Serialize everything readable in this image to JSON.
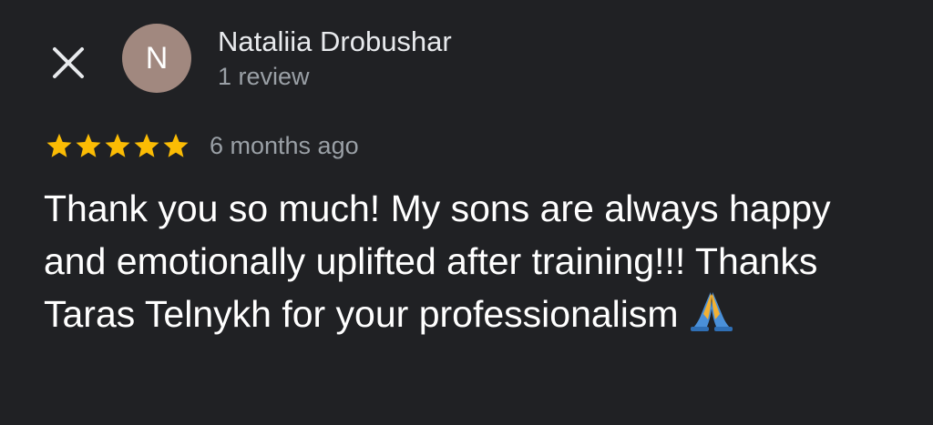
{
  "header": {
    "close_icon": "close-icon",
    "avatar_initial": "N",
    "avatar_color": "#a1887f",
    "reviewer_name": "Nataliia Drobushar",
    "review_count": "1 review"
  },
  "review": {
    "rating": 5,
    "rating_max": 5,
    "star_color": "#fbbc04",
    "age": "6 months ago",
    "text": "Thank you so much! My sons are always happy and emotionally uplifted after training!!! Thanks Taras Telnykh for your professionalism",
    "trailing_emoji": "folded-hands-emoji"
  },
  "theme": {
    "background": "#202124",
    "primary_text": "#ffffff",
    "secondary_text": "#9aa0a6"
  }
}
